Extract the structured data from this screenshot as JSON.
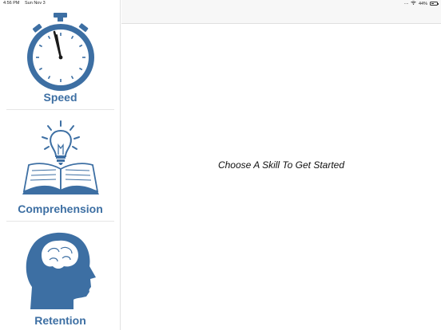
{
  "status_bar": {
    "time": "4:56 PM",
    "date": "Sun Nov 3",
    "battery": "44%"
  },
  "sidebar": {
    "items": [
      {
        "label": "Speed",
        "icon": "stopwatch-icon"
      },
      {
        "label": "Comprehension",
        "icon": "lightbulb-book-icon"
      },
      {
        "label": "Retention",
        "icon": "head-brain-icon"
      }
    ]
  },
  "detail": {
    "prompt": "Choose A Skill To Get Started"
  },
  "colors": {
    "accent": "#3d6fa3",
    "nav_bar": "#f7f7f7"
  }
}
